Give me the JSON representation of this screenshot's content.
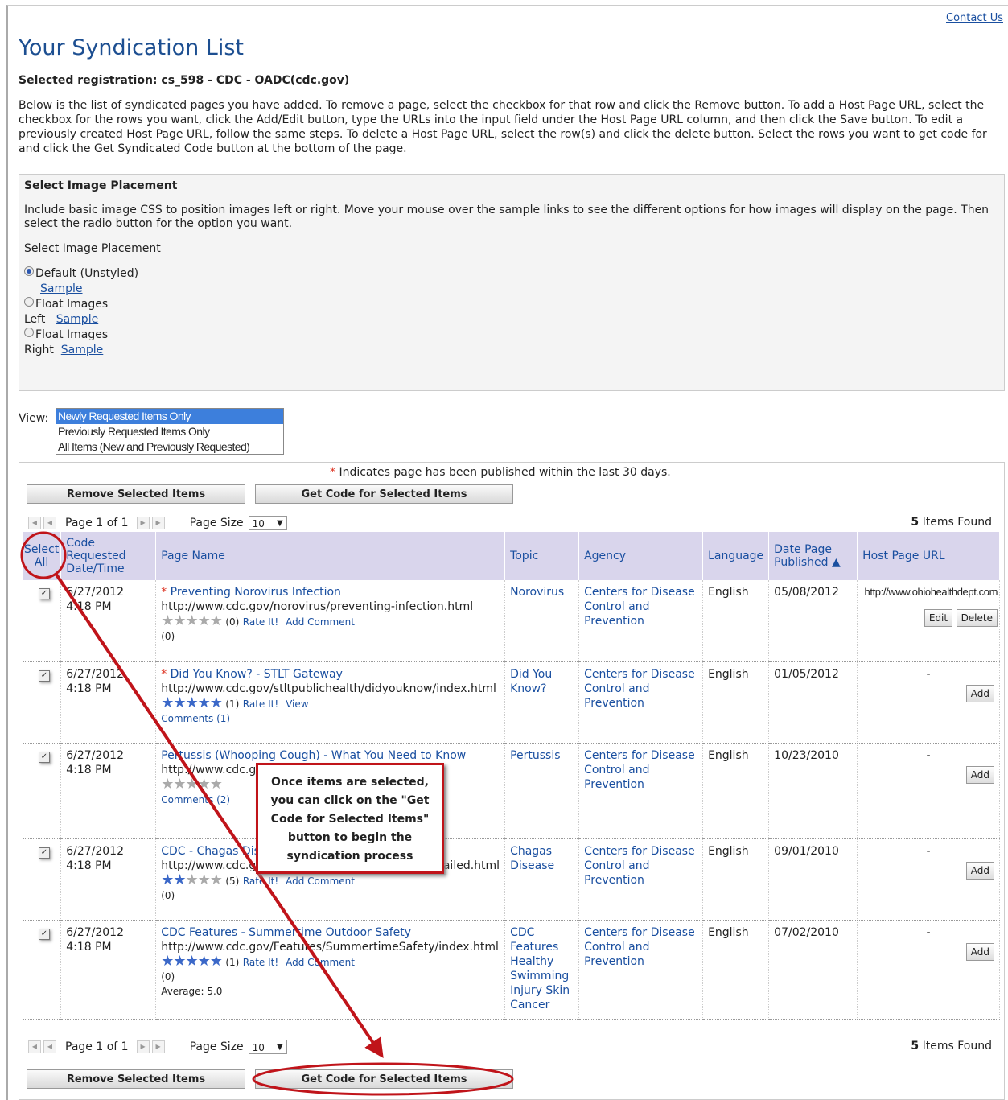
{
  "header": {
    "contact_link": "Contact Us",
    "page_title": "Your Syndication List",
    "registration": "Selected registration: cs_598 - CDC - OADC(cdc.gov)",
    "intro": "Below is the list of syndicated pages you have added. To remove a page, select the checkbox for that row and click the Remove button. To add a Host Page URL, select the checkbox for the rows you want, click the Add/Edit button, type the URLs into the input field under the Host Page URL column, and then click the Save button. To edit a previously created Host Page URL, follow the same steps. To delete a Host Page URL, select the row(s) and click the delete button. Select the rows you want to get code for and click the Get Syndicated Code button at the bottom of the page."
  },
  "image_placement": {
    "heading": "Select Image Placement",
    "description": "Include basic image CSS to position images left or right. Move your mouse over the sample links to see the different options for how images will display on the page. Then select the radio button for the option you want.",
    "sub_label": "Select Image Placement",
    "options": [
      {
        "label_line1": "Default (Unstyled)",
        "label_line2": "",
        "sample": "Sample",
        "selected": true
      },
      {
        "label_line1": "Float Images",
        "label_line2": "Left",
        "sample": "Sample",
        "selected": false
      },
      {
        "label_line1": "Float Images",
        "label_line2": "Right",
        "sample": "Sample",
        "selected": false
      }
    ]
  },
  "view": {
    "label": "View:",
    "options": [
      "Newly Requested Items Only",
      "Previously Requested Items Only",
      "All Items (New and Previously Requested)"
    ],
    "selected_index": 0
  },
  "list": {
    "notice_star": "*",
    "notice": "Indicates page has been published within the last 30 days.",
    "remove_button": "Remove Selected Items",
    "get_code_button": "Get Code for Selected Items",
    "pager_text": "Page 1 of 1",
    "page_size_label": "Page Size",
    "page_size_value": "10",
    "items_found_count": "5",
    "items_found_label": "Items Found",
    "columns": {
      "select_all": "Select All",
      "code_requested": "Code Requested Date/Time",
      "page_name": "Page Name",
      "topic": "Topic",
      "agency": "Agency",
      "language": "Language",
      "date_published": "Date Page Published",
      "host_url": "Host Page URL"
    },
    "rows": [
      {
        "date": "6/27/2012",
        "time": "4:18 PM",
        "star": "*",
        "name": "Preventing Norovirus Infection",
        "url": "http://www.cdc.gov/norovirus/preventing-infection.html",
        "stars_on": 0,
        "rating_count": "(0)",
        "rate": "Rate It!",
        "action": "Add Comment",
        "comments": "(0)",
        "average": "",
        "topic": "Norovirus",
        "agency": "Centers for Disease Control and Prevention",
        "language": "English",
        "published": "05/08/2012",
        "host": "http://www.ohiohealthdept.com",
        "btn1": "Edit",
        "btn2": "Delete"
      },
      {
        "date": "6/27/2012",
        "time": "4:18 PM",
        "star": "*",
        "name": "Did You Know? - STLT Gateway",
        "url": "http://www.cdc.gov/stltpublichealth/didyouknow/index.html",
        "stars_on": 5,
        "rating_count": "(1)",
        "rate": "Rate It!",
        "action": "View",
        "comments": "Comments (1)",
        "average": "",
        "topic": "Did You Know?",
        "agency": "Centers for Disease Control and Prevention",
        "language": "English",
        "published": "01/05/2012",
        "host": "-",
        "btn1": "Add",
        "btn2": ""
      },
      {
        "date": "6/27/2012",
        "time": "4:18 PM",
        "star": "",
        "name": "Pertussis (Whooping Cough) - What You Need to Know",
        "url": "http://www.cdc.gov/Features/Pertussis/index.html",
        "stars_on": 0,
        "rating_count": "",
        "rate": "",
        "action": "",
        "comments": "Comments (2)",
        "average": "",
        "topic": "Pertussis",
        "agency": "Centers for Disease Control and Prevention",
        "language": "English",
        "published": "10/23/2010",
        "host": "-",
        "btn1": "Add",
        "btn2": ""
      },
      {
        "date": "6/27/2012",
        "time": "4:18 PM",
        "star": "",
        "name": "CDC - Chagas Disease",
        "url": "http://www.cdc.gov/parasites/chagas/gen_info/detailed.html",
        "stars_on": 2,
        "rating_count": "(5)",
        "rate": "Rate It!",
        "action": "Add Comment",
        "comments": "(0)",
        "average": "",
        "topic": "Chagas Disease",
        "agency": "Centers for Disease Control and Prevention",
        "language": "English",
        "published": "09/01/2010",
        "host": "-",
        "btn1": "Add",
        "btn2": ""
      },
      {
        "date": "6/27/2012",
        "time": "4:18 PM",
        "star": "",
        "name": "CDC Features - Summertime Outdoor Safety",
        "url": "http://www.cdc.gov/Features/SummertimeSafety/index.html",
        "stars_on": 5,
        "rating_count": "(1)",
        "rate": "Rate It!",
        "action": "Add Comment",
        "comments": "(0)",
        "average": "Average: 5.0",
        "topic": "CDC Features Healthy Swimming Injury Skin Cancer",
        "agency": "Centers for Disease Control and Prevention",
        "language": "English",
        "published": "07/02/2010",
        "host": "-",
        "btn1": "Add",
        "btn2": ""
      }
    ]
  },
  "callout": {
    "text": "Once items are selected, you can click on the \"Get Code for Selected Items\" button to begin the syndication process"
  },
  "colors": {
    "accent": "#1d4f91",
    "annotation_red": "#c0141a",
    "header_bg": "#d9d5ec"
  }
}
